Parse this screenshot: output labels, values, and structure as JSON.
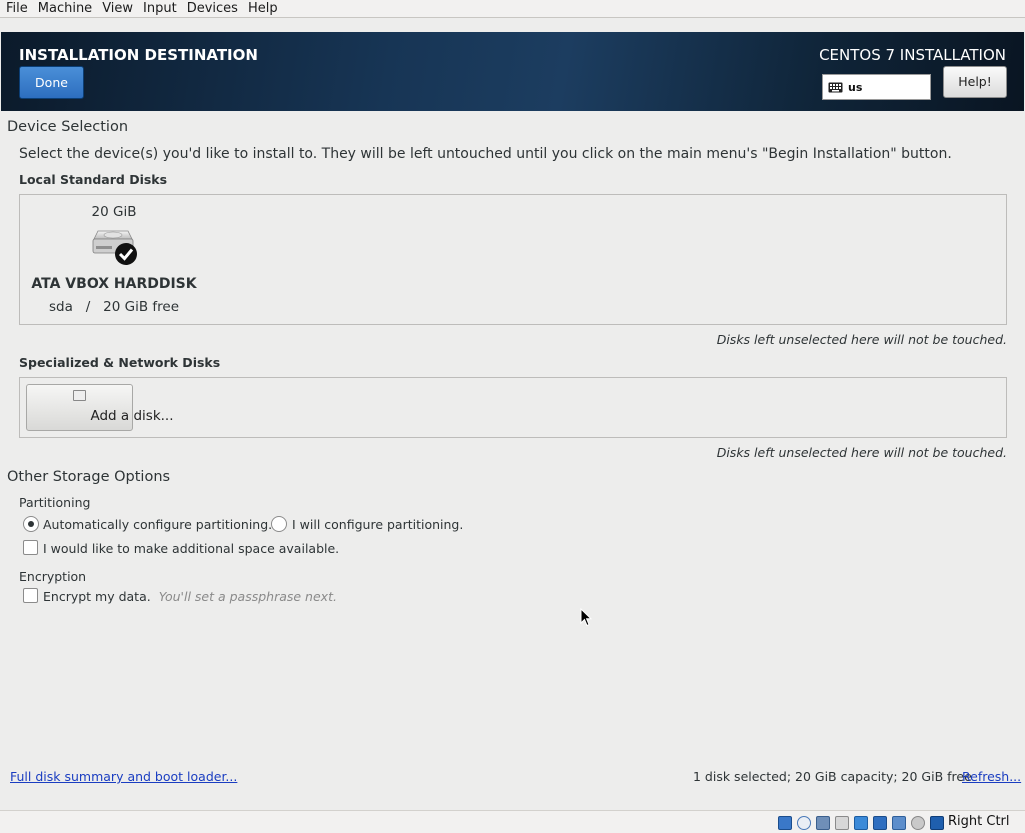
{
  "menubar": {
    "items": [
      {
        "label": "File"
      },
      {
        "label": "Machine"
      },
      {
        "label": "View"
      },
      {
        "label": "Input"
      },
      {
        "label": "Devices"
      },
      {
        "label": "Help"
      }
    ]
  },
  "header": {
    "title": "INSTALLATION DESTINATION",
    "done_label": "Done",
    "product": "CENTOS 7 INSTALLATION",
    "keyboard_layout": "us",
    "help_label": "Help!"
  },
  "device_selection": {
    "title": "Device Selection",
    "description": "Select the device(s) you'd like to install to.  They will be left untouched until you click on the main menu's \"Begin Installation\" button.",
    "local_disks_label": "Local Standard Disks",
    "disk": {
      "size": "20 GiB",
      "name": "ATA VBOX HARDDISK",
      "details": "sda   /   20 GiB free",
      "selected": true
    },
    "local_note": "Disks left unselected here will not be touched.",
    "special_disks_label": "Specialized & Network Disks",
    "add_disk_label": "Add a disk...",
    "special_note": "Disks left unselected here will not be touched."
  },
  "other_storage": {
    "title": "Other Storage Options",
    "partitioning_label": "Partitioning",
    "auto_partition_label": "Automatically configure partitioning.",
    "manual_partition_label": "I will configure partitioning.",
    "auto_selected": true,
    "extra_space_label": "I would like to make additional space available.",
    "encryption_label": "Encryption",
    "encrypt_label": "Encrypt my data.",
    "encrypt_hint": "You'll set a passphrase next."
  },
  "footer": {
    "summary_link": "Full disk summary and boot loader...",
    "status": "1 disk selected; 20 GiB capacity; 20 GiB free",
    "refresh_link": "Refresh..."
  },
  "vbox_statusbar": {
    "host_key": "Right Ctrl",
    "icons": [
      "hard-disk-icon",
      "optical-drive-icon",
      "usb-icon",
      "shared-folders-icon",
      "display-icon",
      "network-icon",
      "recording-icon",
      "cpu-icon",
      "mouse-integration-icon",
      "keyboard-capture-icon"
    ]
  },
  "colors": {
    "header_gradient_dark": "#0b1a2a",
    "header_gradient_mid": "#1c3d60",
    "done_button": "#2d6ebf",
    "link": "#1a3dc1",
    "background": "#ededec"
  }
}
